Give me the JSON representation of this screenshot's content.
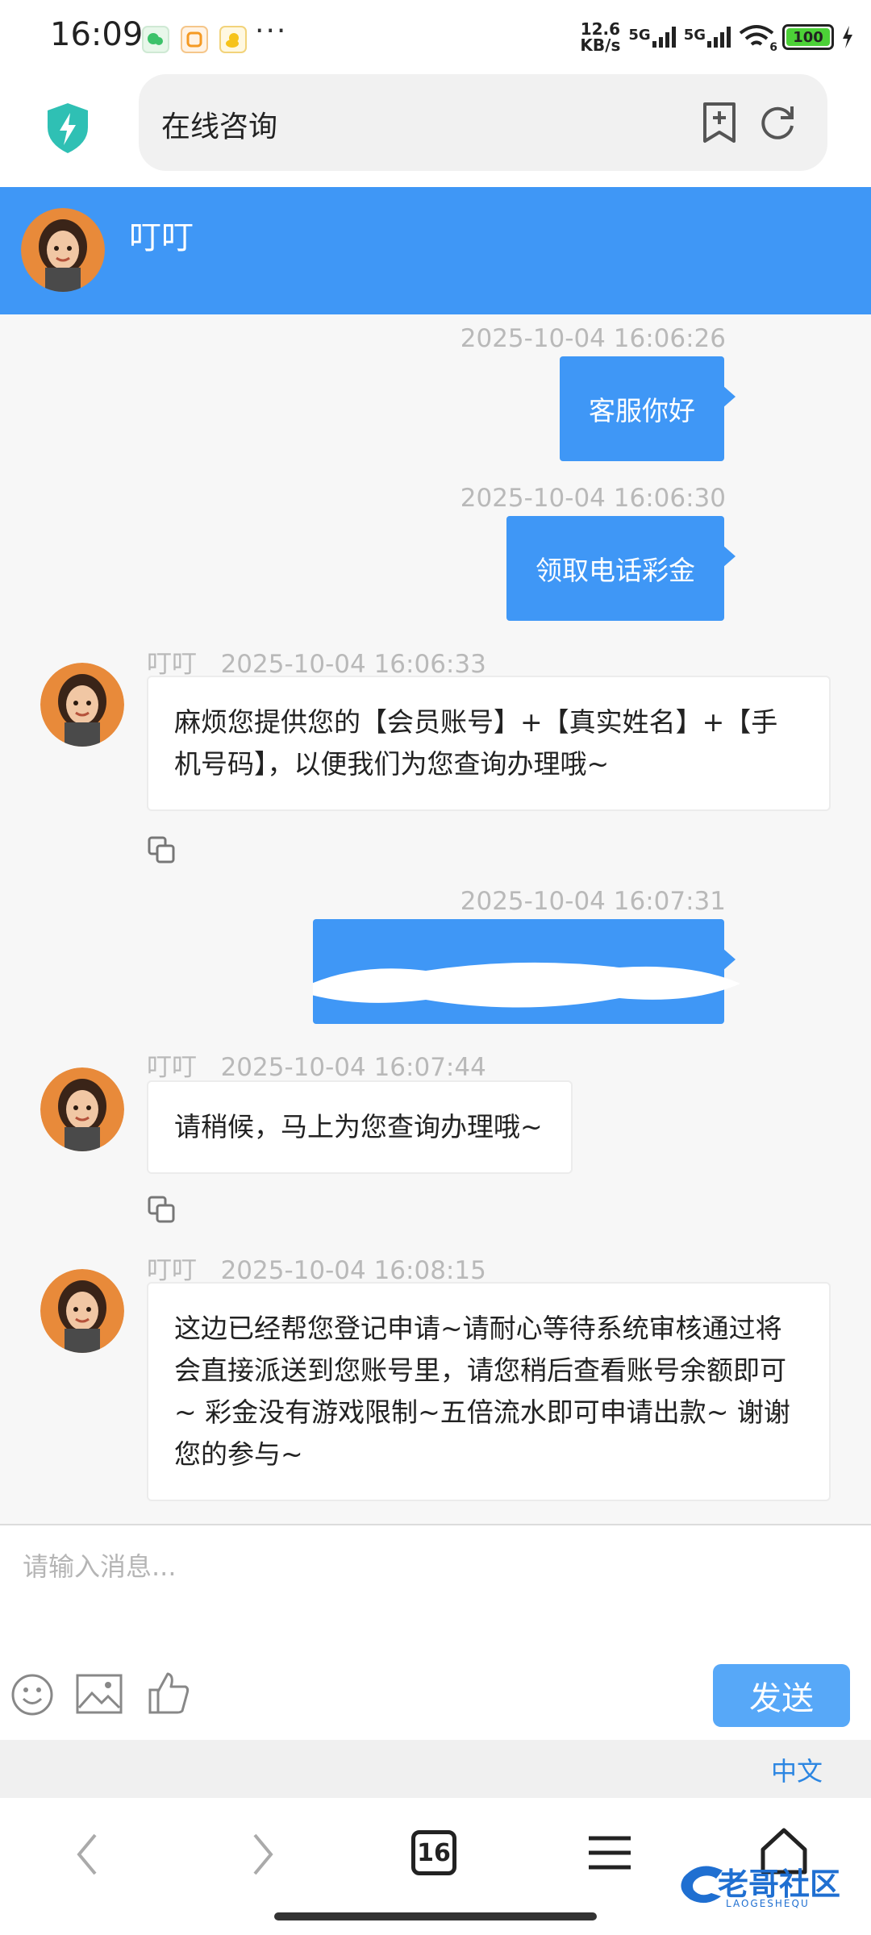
{
  "status_bar": {
    "time": "16:09",
    "more": "···",
    "net_speed_value": "12.6",
    "net_speed_unit": "KB/s",
    "sim1": "5G",
    "sim2": "5G",
    "wifi_badge": "6",
    "battery": "100"
  },
  "address_bar": {
    "title": "在线咨询"
  },
  "chat_header": {
    "agent_name": "叮叮"
  },
  "messages": [
    {
      "direction": "out",
      "time": "2025-10-04 16:06:26",
      "text": "客服你好"
    },
    {
      "direction": "out",
      "time": "2025-10-04 16:06:30",
      "text": "领取电话彩金"
    },
    {
      "direction": "in",
      "sender": "叮叮",
      "time": "2025-10-04 16:06:33",
      "text": "麻烦您提供您的【会员账号】+【真实姓名】+【手机号码】，以便我们为您查询办理哦~"
    },
    {
      "direction": "out",
      "time": "2025-10-04 16:07:31",
      "text": "",
      "redacted": true
    },
    {
      "direction": "in",
      "sender": "叮叮",
      "time": "2025-10-04 16:07:44",
      "text": "请稍候，马上为您查询办理哦~"
    },
    {
      "direction": "in",
      "sender": "叮叮",
      "time": "2025-10-04 16:08:15",
      "text": "这边已经帮您登记申请~请耐心等待系统审核通过将会直接派送到您账号里，请您稍后查看账号余额即可~ 彩金没有游戏限制~五倍流水即可申请出款~ 谢谢您的参与~"
    }
  ],
  "composer": {
    "placeholder": "请输入消息...",
    "send_label": "发送",
    "language": "中文"
  },
  "browser_nav": {
    "tab_count": "16"
  },
  "watermark": {
    "text": "老哥社区",
    "subtext": "LAOGESHEQU"
  },
  "colors": {
    "accent": "#3f97f6",
    "send_button": "#57a8f8",
    "language_link": "#2c86e2"
  }
}
